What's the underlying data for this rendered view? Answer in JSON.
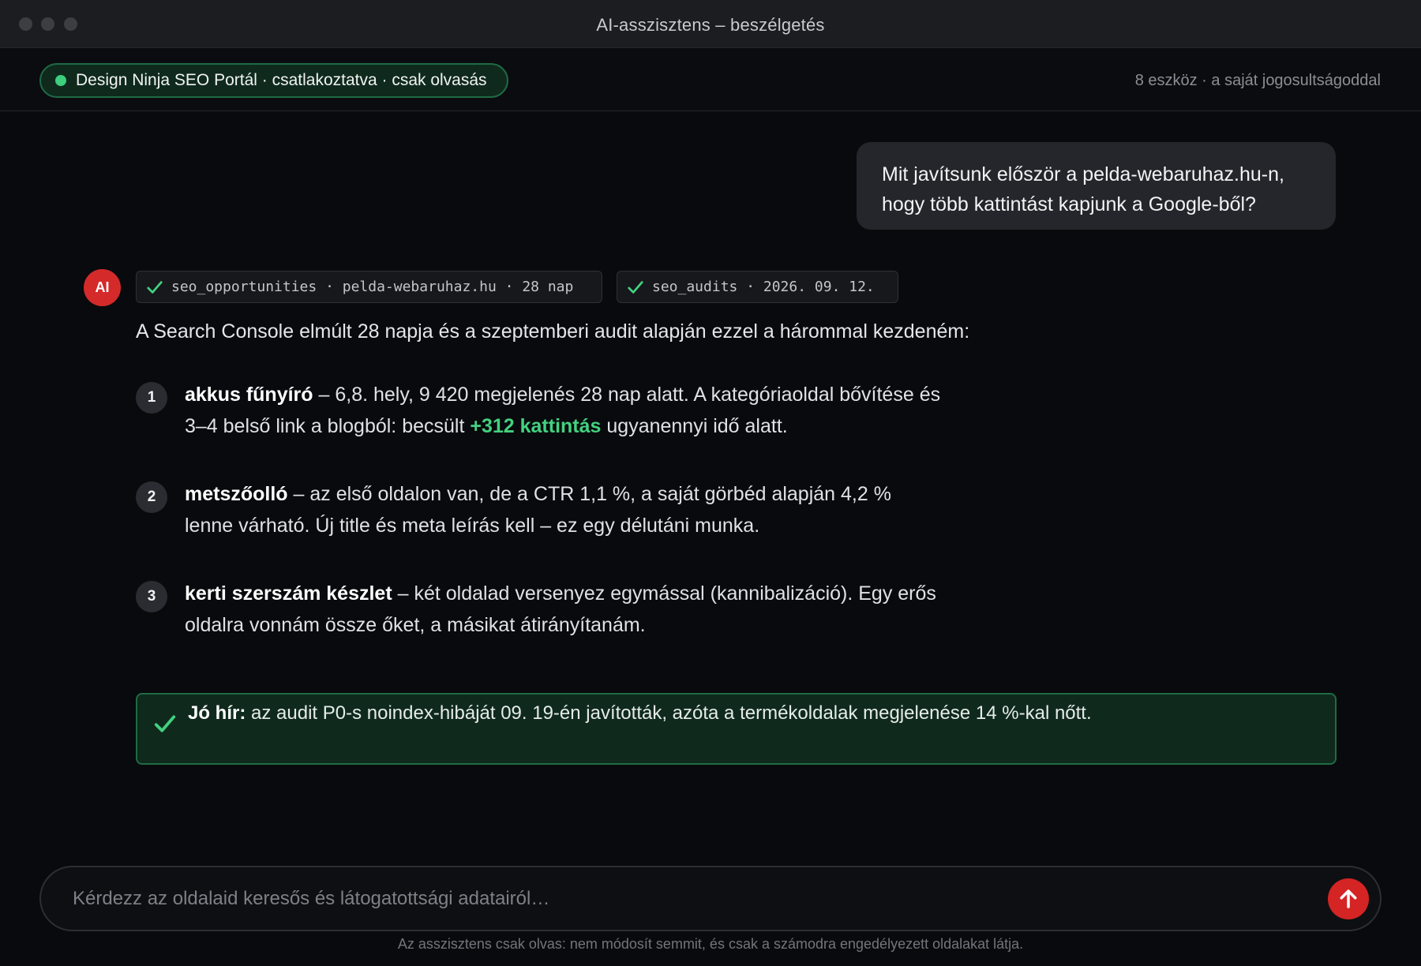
{
  "window": {
    "title": "AI-asszisztens – beszélgetés"
  },
  "connection": {
    "status_text": "Design Ninja SEO Portál · csatlakoztatva · csak olvasás",
    "tools_info": "8 eszköz · a saját jogosultságoddal",
    "status_color": "#3ccf7e"
  },
  "conversation": {
    "user_message": "Mit javítsunk először a pelda-webaruhaz.hu-n, hogy több kattintást kapjunk a Google-ből?",
    "assistant": {
      "avatar_label": "AI",
      "tool_calls": [
        {
          "label": "seo_opportunities · pelda-webaruhaz.hu · 28 nap",
          "status": "done"
        },
        {
          "label": "seo_audits · 2026. 09. 12.",
          "status": "done"
        }
      ],
      "intro": "A Search Console elmúlt 28 napja és a szeptemberi audit alapján ezzel a hárommal kezdeném:",
      "items": [
        {
          "number": "1",
          "title": "akkus fűnyíró",
          "text_before": " – 6,8. hely, 9 420 megjelenés 28 nap alatt. A kategóriaoldal bővítése és 3–4 belső link a blogból: becsült ",
          "highlight": "+312 kattintás",
          "text_after": " ugyanennyi idő alatt."
        },
        {
          "number": "2",
          "title": "metszőolló",
          "text_before": " – az első oldalon van, de a CTR 1,1 %, a saját görbéd alapján 4,2 % lenne várható. Új title és meta leírás kell – ez egy délutáni munka.",
          "highlight": "",
          "text_after": ""
        },
        {
          "number": "3",
          "title": "kerti szerszám készlet",
          "text_before": " – két oldalad versenyez egymással (kannibalizáció). Egy erős oldalra vonnám össze őket, a másikat átirányítanám.",
          "highlight": "",
          "text_after": ""
        }
      ],
      "good_news": {
        "label": "Jó hír:",
        "text": " az audit P0-s noindex-hibáját 09. 19-én javították, azóta a termékoldalak megjelenése 14 %-kal nőtt."
      }
    }
  },
  "composer": {
    "placeholder": "Kérdezz az oldalaid keresős és látogatottsági adatairól…",
    "value": "",
    "send_icon": "arrow-up-icon"
  },
  "footer": {
    "note": "Az asszisztens csak olvas: nem módosít semmit, és csak a számodra engedélyezett oldalakat látja."
  },
  "colors": {
    "accent_red": "#d42424",
    "success_green": "#43d17f",
    "success_bg": "#0f2a1d",
    "success_border": "#1f6b45"
  }
}
